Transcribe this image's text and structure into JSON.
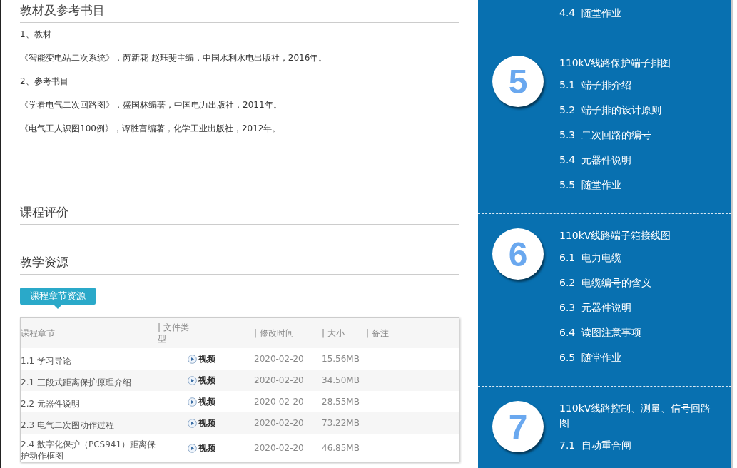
{
  "textbook_section": {
    "title": "教材及参考书目",
    "lines": [
      "1、教材",
      "《智能变电站二次系统》，芮新花 赵珏斐主编，中国水利水电出版社，2016年。",
      "2、参考书目",
      "《学看电气二次回路图》，盛国林编著，中国电力出版社，2011年。",
      "《电气工人识图100例》，谭胜富编著，化学工业出版社，2012年。"
    ]
  },
  "evaluation_section": {
    "title": "课程评价"
  },
  "resources_section": {
    "title": "教学资源",
    "tab": "课程章节资源",
    "table": {
      "columns": [
        "课程章节",
        "| 文件类型",
        "| 修改时间",
        "| 大小",
        "| 备注"
      ],
      "rows": [
        {
          "chapter": "1.1 学习导论",
          "type": "视频",
          "modified": "2020-02-20",
          "size": "15.56MB"
        },
        {
          "chapter": "2.1 三段式距离保护原理介绍",
          "type": "视频",
          "modified": "2020-02-20",
          "size": "34.50MB"
        },
        {
          "chapter": "2.2 元器件说明",
          "type": "视频",
          "modified": "2020-02-20",
          "size": "28.55MB"
        },
        {
          "chapter": "2.3 电气二次图动作过程",
          "type": "视频",
          "modified": "2020-02-20",
          "size": "73.22MB"
        },
        {
          "chapter": "2.4 数字化保护（PCS941）距离保护动作框图",
          "type": "视频",
          "modified": "2020-02-20",
          "size": "46.85MB"
        }
      ]
    }
  },
  "syllabus": {
    "partial_items": [
      {
        "number": "4.4",
        "label": "随堂作业"
      }
    ],
    "units": [
      {
        "number": "5",
        "title": "110kV线路保护端子排图",
        "items": [
          {
            "number": "5.1",
            "label": "端子排介绍"
          },
          {
            "number": "5.2",
            "label": "端子排的设计原则"
          },
          {
            "number": "5.3",
            "label": "二次回路的编号"
          },
          {
            "number": "5.4",
            "label": "元器件说明"
          },
          {
            "number": "5.5",
            "label": "随堂作业"
          }
        ]
      },
      {
        "number": "6",
        "title": "110kV线路端子箱接线图",
        "items": [
          {
            "number": "6.1",
            "label": "电力电缆"
          },
          {
            "number": "6.2",
            "label": "电缆编号的含义"
          },
          {
            "number": "6.3",
            "label": "元器件说明"
          },
          {
            "number": "6.4",
            "label": "读图注意事项"
          },
          {
            "number": "6.5",
            "label": "随堂作业"
          }
        ]
      },
      {
        "number": "7",
        "title": "110kV线路控制、测量、信号回路图",
        "items": [
          {
            "number": "7.1",
            "label": "自动重合闸"
          }
        ]
      }
    ]
  }
}
